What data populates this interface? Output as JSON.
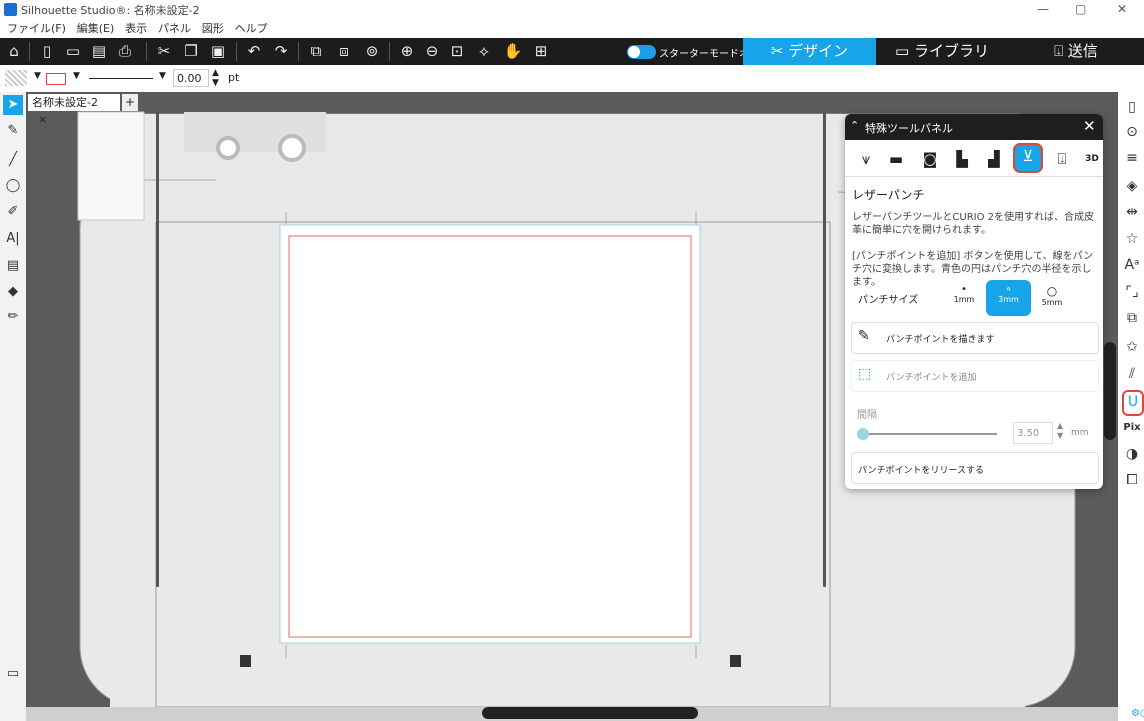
{
  "window": {
    "title": "Silhouette Studio®: 名称未設定-2",
    "minimize": "—",
    "restore": "▢",
    "close": "✕"
  },
  "menu": [
    "ファイル(F)",
    "編集(E)",
    "表示",
    "パネル",
    "図形",
    "ヘルプ"
  ],
  "toolbar": {
    "mode_label": "スターターモードオフ",
    "tabs": {
      "design": "デザイン",
      "library": "ライブラリ",
      "send": "送信"
    },
    "design_icon": "✂",
    "library_icon": "▭",
    "send_icon": "⍗"
  },
  "propbar": {
    "line_width": "0.00",
    "unit": "pt"
  },
  "document": {
    "tab_label": "名称未設定-2",
    "tab_close": "×",
    "add_tab": "+"
  },
  "panel": {
    "title": "特殊ツールパネル",
    "close": "✕",
    "heading": "レザーパンチ",
    "desc1": "レザーパンチツールとCURIO 2を使用すれば、合成皮革に簡単に穴を開けられます。",
    "desc2": "[パンチポイントを追加] ボタンを使用して、線をパンチ穴に変換します。青色の円はパンチ穴の半径を示します。",
    "punch_size_label": "パンチサイズ",
    "sizes": [
      {
        "label": "1mm",
        "glyph": "•"
      },
      {
        "label": "3mm",
        "glyph": "∘"
      },
      {
        "label": "5mm",
        "glyph": "○"
      }
    ],
    "selected_size": "3mm",
    "draw_points": "パンチポイントを描きます",
    "add_points": "パンチポイントを追加",
    "spacing_label": "間隔",
    "spacing_value": "3.50",
    "spacing_unit": "mm",
    "release": "パンチポイントをリリースする"
  },
  "colors": {
    "accent": "#17a4e8",
    "highlight_border": "#e0463a",
    "toolbar_bg": "#1c1c1c",
    "canvas_bg": "#5b5b5b"
  }
}
